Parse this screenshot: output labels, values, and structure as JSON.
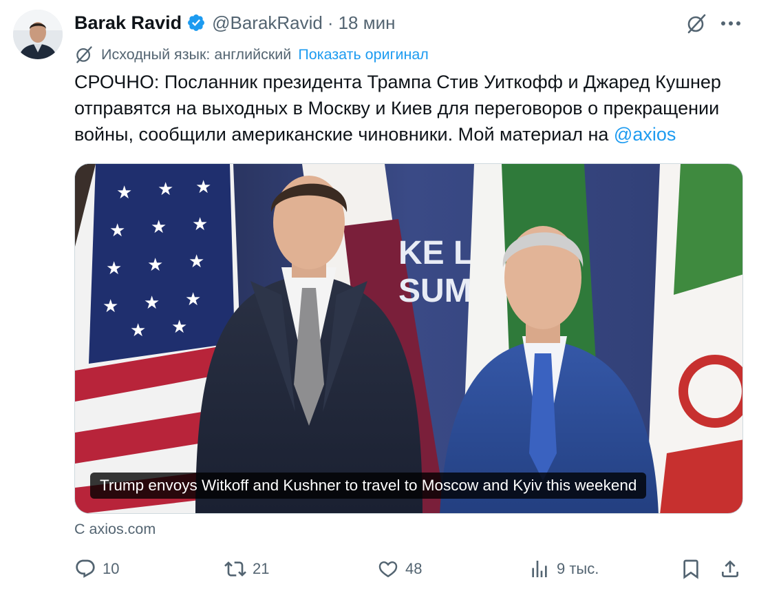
{
  "author": {
    "name": "Barak Ravid",
    "handle": "@BarakRavid",
    "separator": "·",
    "time": "18 мин"
  },
  "translation": {
    "note": "Исходный язык: английский",
    "show_original": "Показать оригинал"
  },
  "tweet": {
    "text": "СРОЧНО: Посланник президента Трампа Стив Уиткофф и Джаред Кушнер отправятся на выходных в Москву и Киев для переговоров о прекращении войны, сообщили американские чиновники. Мой материал на ",
    "mention": "@axios"
  },
  "card": {
    "backdrop_text_1": "KE LU",
    "backdrop_text_2": "SUM",
    "caption": "Trump envoys Witkoff and Kushner to travel to Moscow and Kyiv this weekend",
    "source": "С axios.com"
  },
  "actions": {
    "reply_count": "10",
    "repost_count": "21",
    "like_count": "48",
    "views_count": "9 тыс."
  },
  "colors": {
    "accent": "#1d9bf0",
    "text": "#0f1419",
    "secondary": "#536471",
    "verified": "#1d9bf0"
  },
  "icons": {
    "verified": "verified-badge-icon",
    "grok": "grok-icon",
    "more": "more-icon",
    "reply": "reply-icon",
    "repost": "repost-icon",
    "like": "like-icon",
    "views": "views-icon",
    "bookmark": "bookmark-icon",
    "share": "share-icon"
  }
}
